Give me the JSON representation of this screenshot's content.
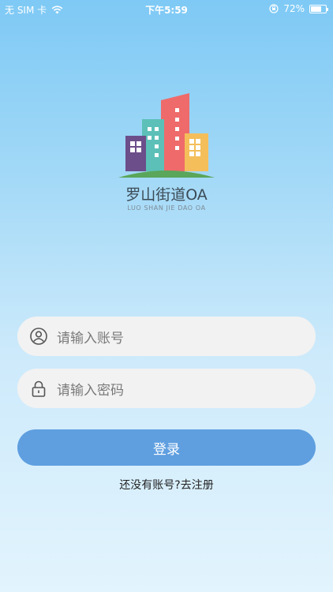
{
  "status_bar": {
    "carrier": "无 SIM 卡",
    "time": "下午5:59",
    "battery_percent": "72%",
    "battery_level": 0.72
  },
  "app": {
    "name": "罗山街道OA",
    "subname": "LUO SHAN JIE DAO OA"
  },
  "form": {
    "account_placeholder": "请输入账号",
    "password_placeholder": "请输入密码",
    "login_label": "登录",
    "register_text": "还没有账号?去注册"
  },
  "icons": {
    "account": "user-circle-icon",
    "password": "lock-icon",
    "wifi": "wifi-icon",
    "lock_rotation": "rotation-lock-icon"
  },
  "colors": {
    "button": "#5f9fe0",
    "field_bg": "#f2f2f2"
  }
}
